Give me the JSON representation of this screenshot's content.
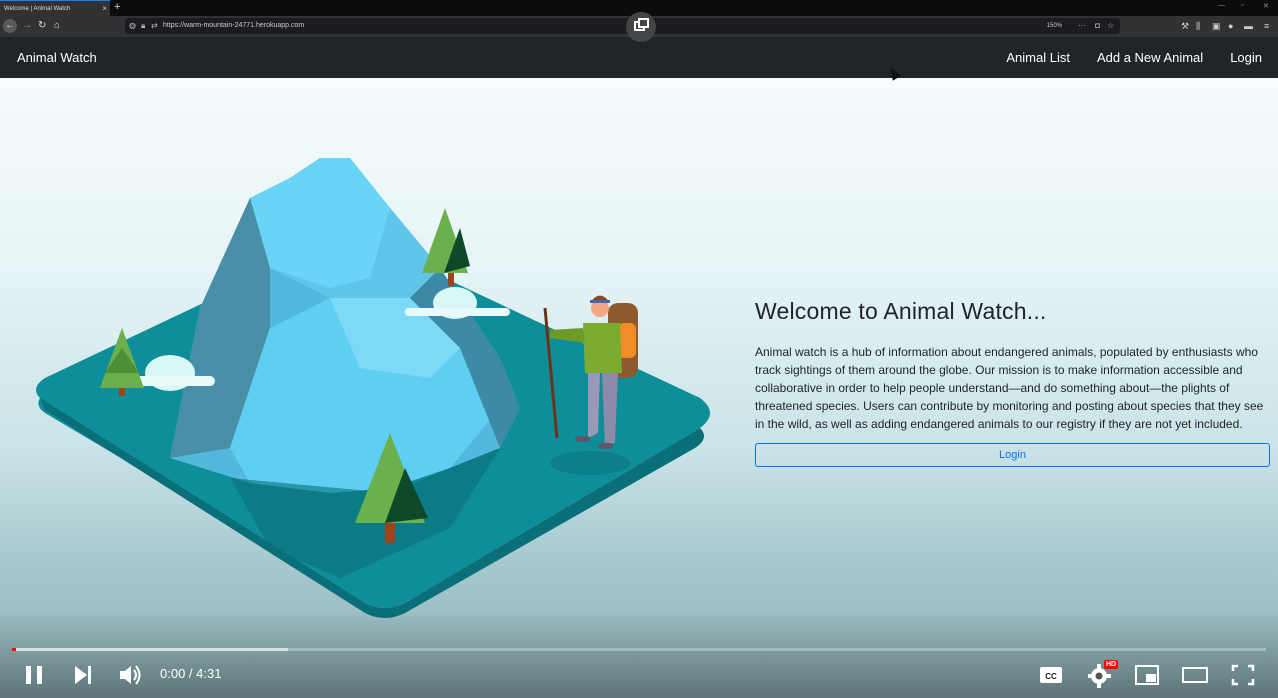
{
  "browser": {
    "tab_title": "Welcome | Animal Watch",
    "tab_close": "×",
    "new_tab": "+",
    "url": "https://warm-mountain-24771.herokuapp.com",
    "zoom": "150%"
  },
  "nav": {
    "brand": "Animal Watch",
    "links": [
      "Animal List",
      "Add a New Animal",
      "Login"
    ]
  },
  "hero": {
    "title": "Welcome to Animal Watch...",
    "description": "Animal watch is a hub of information about endangered animals, populated by enthusiasts who track sightings of them around the globe. Our mission is to make information accessible and collaborative in order to help people understand—and do something about—the plights of threatened species. Users can contribute by monitoring and posting about species that they see in the wild, as well as adding endangered animals to our registry if they are not yet included.",
    "login_button": "Login"
  },
  "video": {
    "time": "0:00 / 4:31",
    "hd_badge": "HD",
    "cc_label": "CC",
    "progress_played": 0.003,
    "progress_buffered": 0.22
  },
  "colors": {
    "nav_bg": "#212529",
    "primary": "#0d6efd",
    "island": "#0e8e99",
    "mountain": "#5fd0f5",
    "tree": "#6ab04c"
  }
}
